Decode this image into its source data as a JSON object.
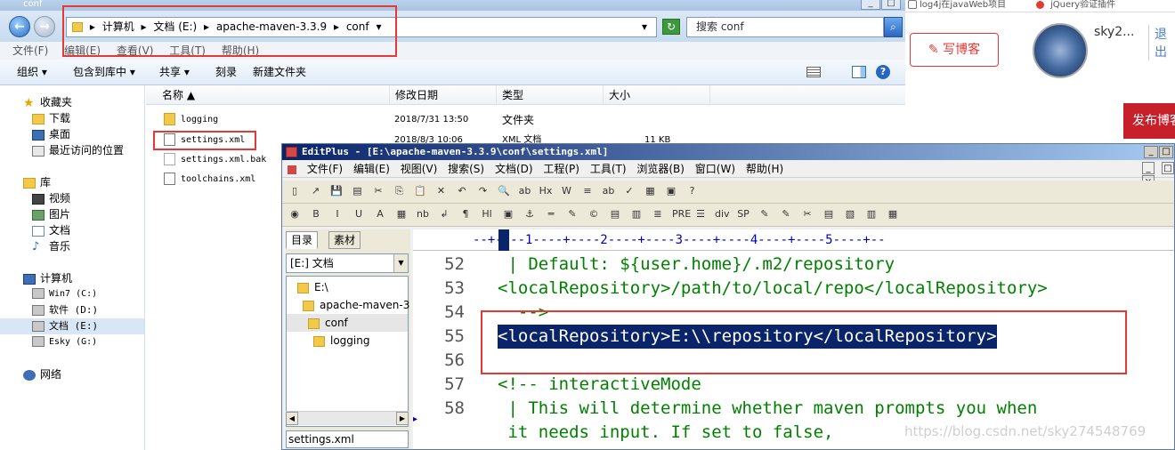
{
  "explorer": {
    "title": "conf",
    "window_buttons": [
      "_",
      "□"
    ],
    "back_arrow": "←",
    "forward_arrow": "→",
    "breadcrumb": [
      "计算机",
      "▸",
      "文档 (E:)",
      "▸",
      "apache-maven-3.3.9",
      "▸",
      "conf",
      "▾"
    ],
    "address_dropdown": "▾",
    "refresh_glyph": "↻",
    "search_placeholder": "搜索 conf",
    "search_glyph": "⌕",
    "menu": [
      "文件(F)",
      "编辑(E)",
      "查看(V)",
      "工具(T)",
      "帮助(H)"
    ],
    "toolbar": {
      "organize": "组织 ▾",
      "include": "包含到库中 ▾",
      "share": "共享 ▾",
      "burn": "刻录",
      "new_folder": "新建文件夹",
      "help_glyph": "?"
    },
    "nav": {
      "favorites": "收藏夹",
      "downloads": "下载",
      "desktop": "桌面",
      "recent": "最近访问的位置",
      "libraries": "库",
      "videos": "视频",
      "pictures": "图片",
      "documents": "文档",
      "music": "音乐",
      "computer": "计算机",
      "drive_c": "Win7 (C:)",
      "drive_d": "软件 (D:)",
      "drive_e": "文档 (E:)",
      "drive_g": "Esky (G:)",
      "network": "网络"
    },
    "columns": {
      "name": "名称 ▲",
      "date": "修改日期",
      "type": "类型",
      "size": "大小"
    },
    "files": [
      {
        "name": "logging",
        "date": "2018/7/31 13:50",
        "type": "文件夹",
        "size": ""
      },
      {
        "name": "settings.xml",
        "date": "2018/8/3 10:06",
        "type": "XML 文档",
        "size": "11 KB"
      },
      {
        "name": "settings.xml.bak",
        "date": "",
        "type": "",
        "size": ""
      },
      {
        "name": "toolchains.xml",
        "date": "",
        "type": "",
        "size": ""
      }
    ]
  },
  "browser": {
    "tab1": "log4j在javaWeb项目",
    "tab2": "jQuery验证插件",
    "write_blog": "✎ 写博客",
    "username": "sky2...",
    "logout": "退出",
    "publish": "发布博客"
  },
  "editplus": {
    "title": "EditPlus - [E:\\apache-maven-3.3.9\\conf\\settings.xml]",
    "window_buttons": [
      "_",
      "□",
      "×"
    ],
    "menu": [
      "文件(F)",
      "编辑(E)",
      "视图(V)",
      "搜索(S)",
      "文档(D)",
      "工程(P)",
      "工具(T)",
      "浏览器(B)",
      "窗口(W)",
      "帮助(H)"
    ],
    "toolbar1": [
      "▯",
      "↗",
      "💾",
      "▤",
      "✂",
      "⎘",
      "📋",
      "✕",
      "↶",
      "↷",
      "🔍",
      "ab",
      "Hx",
      "W",
      "≡",
      "ab",
      "✓",
      "▦",
      "▣",
      "?"
    ],
    "toolbar2": [
      "◉",
      "B",
      "I",
      "U",
      "A",
      "▦",
      "nb",
      "↲",
      "¶",
      "Hl",
      "▣",
      "⚓",
      "═",
      "✎",
      "©",
      "▤",
      "▥",
      "≣",
      "PRE",
      "☰",
      "div",
      "SP",
      "✎",
      "✎",
      "✂",
      "▤",
      "▧",
      "▥",
      "▦"
    ],
    "left_tabs": [
      "目录",
      "素材"
    ],
    "drive": "[E:] 文档",
    "tree": [
      "E:\\",
      "apache-maven-3",
      "conf",
      "logging"
    ],
    "current_file": "settings.xml",
    "ruler": "--+----1----+----2----+----3----+----4----+----5----+--",
    "gutter_marker": "▸",
    "lines": [
      {
        "num": "52",
        "text": " | Default: ${user.home}/.m2/repository",
        "kind": "comment"
      },
      {
        "num": "53",
        "text": "<localRepository>/path/to/local/repo</localRepository>",
        "kind": "comment"
      },
      {
        "num": "54",
        "text": "  -->",
        "kind": "comment"
      },
      {
        "num": "55",
        "text": "<localRepository>E:\\\\repository</localRepository>",
        "kind": "selected"
      },
      {
        "num": "56",
        "text": "",
        "kind": "blank"
      },
      {
        "num": "57",
        "text": "<!-- interactiveMode",
        "kind": "comment"
      },
      {
        "num": "58",
        "text": " | This will determine whether maven prompts you when",
        "kind": "comment"
      },
      {
        "num": "",
        "text": " it needs input. If set to false,",
        "kind": "comment"
      }
    ]
  },
  "watermark": "https://blog.csdn.net/sky274548769"
}
